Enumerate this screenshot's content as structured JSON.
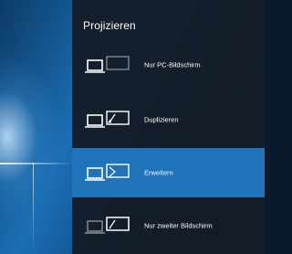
{
  "panel": {
    "title": "Projizieren",
    "options": [
      {
        "label": "Nur PC-Bildschirm",
        "icon": "pc-screen-only-icon",
        "selected": false
      },
      {
        "label": "Duplizieren",
        "icon": "duplicate-icon",
        "selected": false
      },
      {
        "label": "Erweitern",
        "icon": "extend-icon",
        "selected": true
      },
      {
        "label": "Nur zweiter Bildschirm",
        "icon": "second-screen-only-icon",
        "selected": false
      }
    ]
  },
  "colors": {
    "panel_bg": "#141a24",
    "selected_bg": "#1f73b8",
    "text": "#ffffff"
  }
}
